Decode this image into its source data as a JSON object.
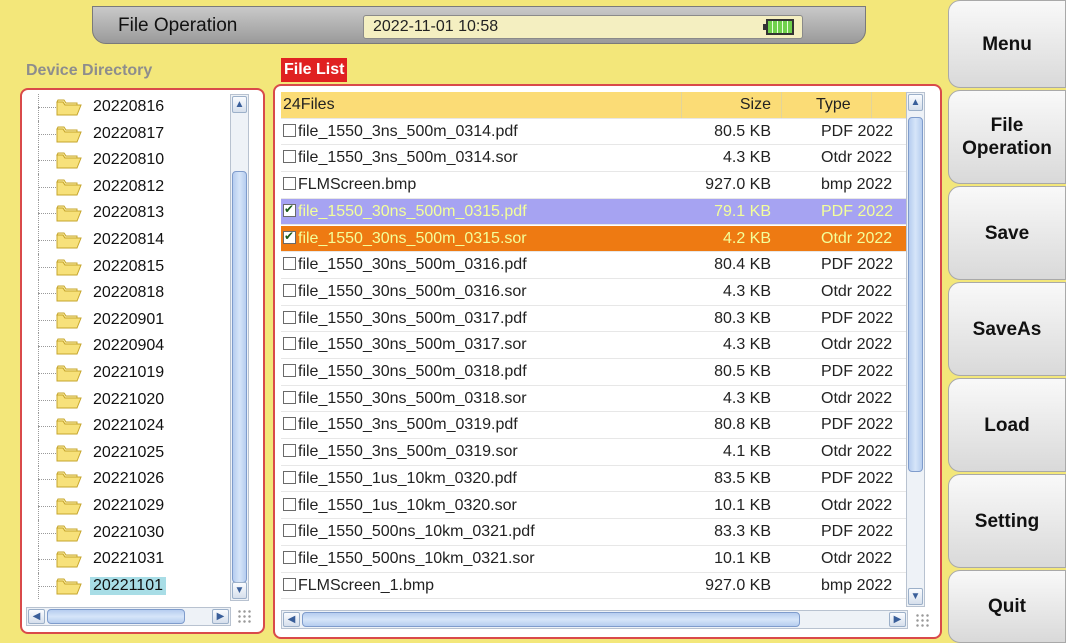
{
  "header": {
    "title": "File Operation",
    "datetime": "2022-11-01 10:58",
    "battery_icon": "battery-icon"
  },
  "directory": {
    "label": "Device Directory",
    "items": [
      {
        "name": "20220816"
      },
      {
        "name": "20220817"
      },
      {
        "name": "20220810"
      },
      {
        "name": "20220812"
      },
      {
        "name": "20220813"
      },
      {
        "name": "20220814"
      },
      {
        "name": "20220815"
      },
      {
        "name": "20220818"
      },
      {
        "name": "20220901"
      },
      {
        "name": "20220904"
      },
      {
        "name": "20221019"
      },
      {
        "name": "20221020"
      },
      {
        "name": "20221024"
      },
      {
        "name": "20221025"
      },
      {
        "name": "20221026"
      },
      {
        "name": "20221029"
      },
      {
        "name": "20221030"
      },
      {
        "name": "20221031"
      },
      {
        "name": "20221101",
        "selected": true
      }
    ]
  },
  "file_list": {
    "label": "File List",
    "header": {
      "name": "24Files",
      "size": "Size",
      "type": "Type"
    },
    "rows": [
      {
        "name": "file_1550_3ns_500m_0314.pdf",
        "size": "80.5 KB",
        "type": "PDF 2022",
        "checked": false
      },
      {
        "name": "file_1550_3ns_500m_0314.sor",
        "size": "4.3 KB",
        "type": "Otdr 2022",
        "checked": false
      },
      {
        "name": "FLMScreen.bmp",
        "size": "927.0 KB",
        "type": "bmp 2022",
        "checked": false
      },
      {
        "name": "file_1550_30ns_500m_0315.pdf",
        "size": "79.1 KB",
        "type": "PDF 2022",
        "checked": true,
        "highlight": "sel1"
      },
      {
        "name": "file_1550_30ns_500m_0315.sor",
        "size": "4.2 KB",
        "type": "Otdr 2022",
        "checked": true,
        "highlight": "sel2"
      },
      {
        "name": "file_1550_30ns_500m_0316.pdf",
        "size": "80.4 KB",
        "type": "PDF 2022",
        "checked": false
      },
      {
        "name": "file_1550_30ns_500m_0316.sor",
        "size": "4.3 KB",
        "type": "Otdr 2022",
        "checked": false
      },
      {
        "name": "file_1550_30ns_500m_0317.pdf",
        "size": "80.3 KB",
        "type": "PDF 2022",
        "checked": false
      },
      {
        "name": "file_1550_30ns_500m_0317.sor",
        "size": "4.3 KB",
        "type": "Otdr 2022",
        "checked": false
      },
      {
        "name": "file_1550_30ns_500m_0318.pdf",
        "size": "80.5 KB",
        "type": "PDF 2022",
        "checked": false
      },
      {
        "name": "file_1550_30ns_500m_0318.sor",
        "size": "4.3 KB",
        "type": "Otdr 2022",
        "checked": false
      },
      {
        "name": "file_1550_3ns_500m_0319.pdf",
        "size": "80.8 KB",
        "type": "PDF 2022",
        "checked": false
      },
      {
        "name": "file_1550_3ns_500m_0319.sor",
        "size": "4.1 KB",
        "type": "Otdr 2022",
        "checked": false
      },
      {
        "name": "file_1550_1us_10km_0320.pdf",
        "size": "83.5 KB",
        "type": "PDF 2022",
        "checked": false
      },
      {
        "name": "file_1550_1us_10km_0320.sor",
        "size": "10.1 KB",
        "type": "Otdr 2022",
        "checked": false
      },
      {
        "name": "file_1550_500ns_10km_0321.pdf",
        "size": "83.3 KB",
        "type": "PDF 2022",
        "checked": false
      },
      {
        "name": "file_1550_500ns_10km_0321.sor",
        "size": "10.1 KB",
        "type": "Otdr 2022",
        "checked": false
      },
      {
        "name": "FLMScreen_1.bmp",
        "size": "927.0 KB",
        "type": "bmp 2022",
        "checked": false
      }
    ]
  },
  "side_menu": [
    {
      "label": "Menu"
    },
    {
      "label": "File Operation"
    },
    {
      "label": "Save"
    },
    {
      "label": "SaveAs"
    },
    {
      "label": "Load"
    },
    {
      "label": "Setting"
    },
    {
      "label": "Quit"
    }
  ]
}
